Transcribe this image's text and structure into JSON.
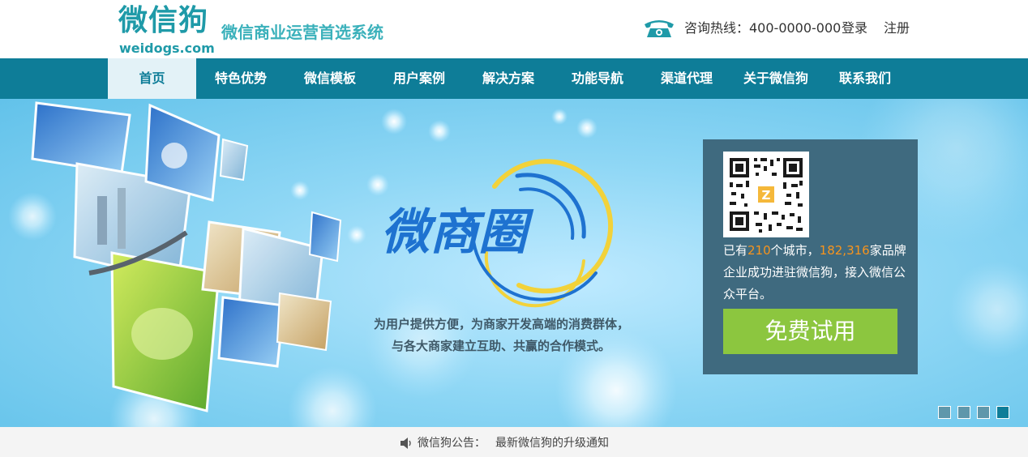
{
  "header": {
    "logo_main": "微信狗",
    "logo_sub": "weidogs.com",
    "slogan": "微信商业运营首选系统",
    "hotline": "咨询热线：400-0000-000",
    "login": "登录",
    "register": "注册"
  },
  "nav": {
    "items": [
      "首页",
      "特色优势",
      "微信模板",
      "用户案例",
      "解决方案",
      "功能导航",
      "渠道代理",
      "关于微信狗",
      "联系我们"
    ],
    "active_index": 0
  },
  "banner": {
    "brand_text": "微商圈",
    "tagline_1": "为用户提供方便，为商家开发高端的消费群体，",
    "tagline_2": "与各大商家建立互助、共赢的合作模式。",
    "promo": {
      "text_1": "已有",
      "cities": "210",
      "text_2": "个城市，",
      "brands": "182,316",
      "text_3": "家品牌企业成功进驻微信狗，接入微信公众平台。",
      "button": "免费试用"
    },
    "slides_count": 4,
    "active_slide": 4
  },
  "notice": {
    "label": "微信狗公告：",
    "link": "最新微信狗的升级通知"
  },
  "colors": {
    "brand_teal": "#0e7d98",
    "logo_teal": "#1f9aa8",
    "highlight_orange": "#f7941d",
    "button_green": "#8cc63f",
    "promo_panel": "#3f6a7f"
  }
}
